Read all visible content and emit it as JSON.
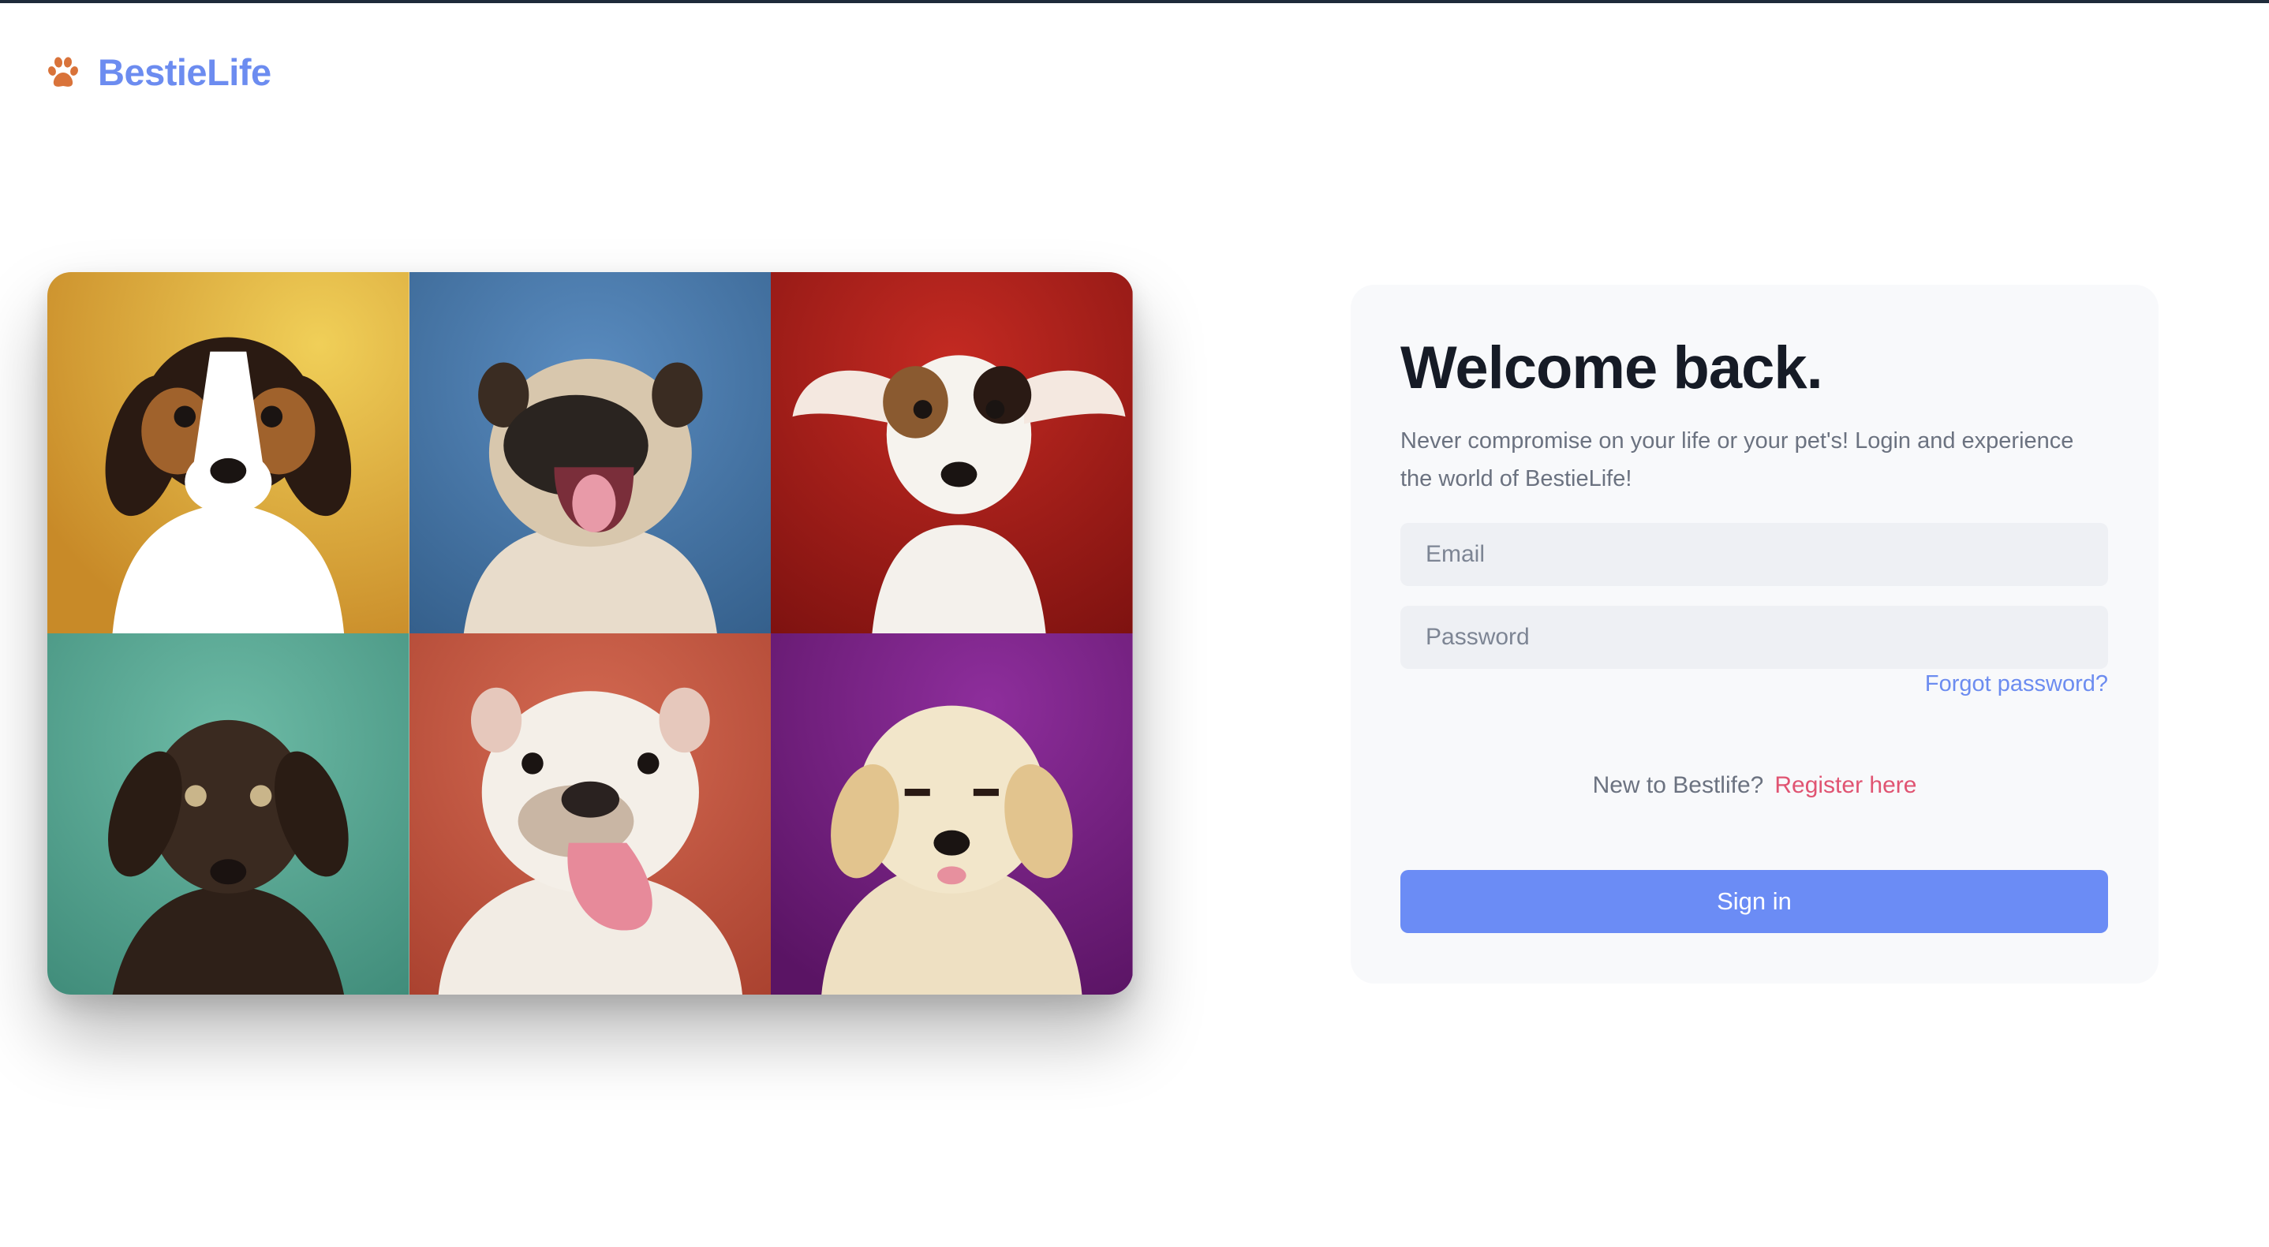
{
  "brand": {
    "name": "BestieLife",
    "icon": "paw-icon",
    "icon_color": "#d9733a",
    "color": "#6c8cf0"
  },
  "hero": {
    "tiles": [
      {
        "name": "beagle-puppy-photo",
        "background": "#e6b944"
      },
      {
        "name": "pug-puppy-photo",
        "background": "#4574a3"
      },
      {
        "name": "jack-russell-puppy-photo",
        "background": "#b01f1d"
      },
      {
        "name": "labrador-puppy-photo",
        "background": "#5fae9a"
      },
      {
        "name": "bulldog-puppy-photo",
        "background": "#cb5a45"
      },
      {
        "name": "golden-retriever-puppy-photo",
        "background": "#7a2a8a"
      }
    ]
  },
  "login": {
    "title": "Welcome back.",
    "subtitle": "Never compromise on your life or your pet's! Login and experience the world of BestieLife!",
    "email_placeholder": "Email",
    "password_placeholder": "Password",
    "forgot_password": "Forgot password?",
    "register_prompt": "New to Bestlife?",
    "register_link": "Register here",
    "signin_label": "Sign in"
  },
  "colors": {
    "primary": "#6b8cf5",
    "link": "#6c8cf0",
    "accent": "#e05472",
    "card_bg": "#f8f9fb"
  }
}
